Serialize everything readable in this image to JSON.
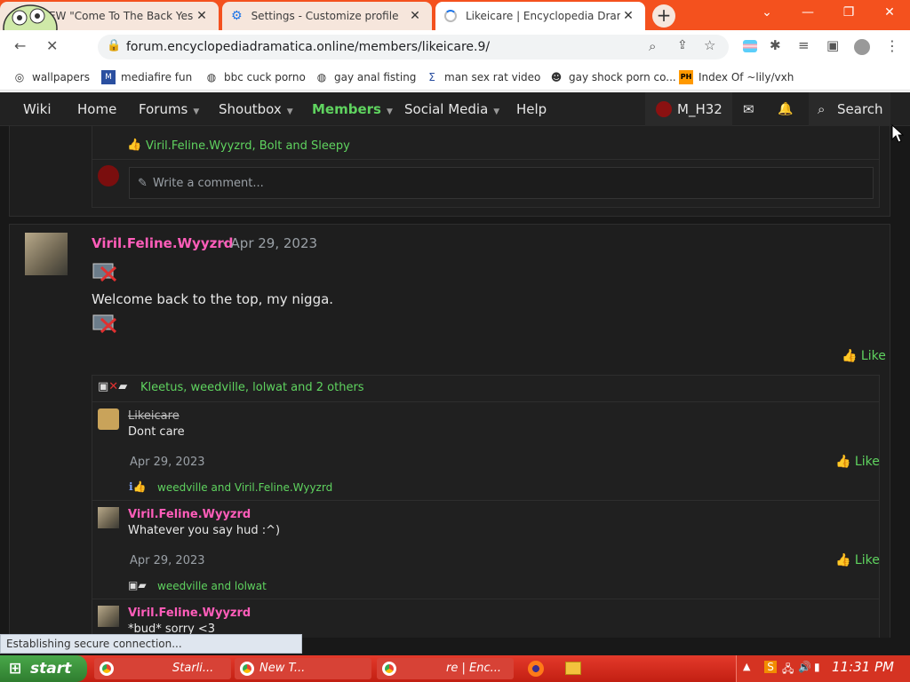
{
  "browser": {
    "tabs": [
      {
        "title": "NEW \"Come To The Back Yes",
        "state": "inactive"
      },
      {
        "title": "Settings - Customize profile",
        "state": "inactive"
      },
      {
        "title": "Likeicare | Encyclopedia Drama",
        "state": "active"
      }
    ],
    "new_tab": "+",
    "url": "forum.encyclopediadramatica.online/members/likeicare.9/",
    "bookmarks": [
      {
        "label": "wallpapers",
        "icon": "coil-icon"
      },
      {
        "label": "mediafire fun",
        "icon": "mediafire-icon"
      },
      {
        "label": "bbc cuck porno",
        "icon": "globe-icon"
      },
      {
        "label": "gay anal fisting",
        "icon": "globe-icon"
      },
      {
        "label": "man sex rat video",
        "icon": "sigma-icon"
      },
      {
        "label": "gay shock porn co...",
        "icon": "mascot-icon"
      },
      {
        "label": "Index Of ~lily/vxh",
        "icon": "ph-icon"
      }
    ]
  },
  "forum_nav": {
    "items": [
      "Wiki",
      "Home",
      "Forums",
      "Shoutbox",
      "Members",
      "Social Media",
      "Help"
    ],
    "active": "Members",
    "user": "M_H32",
    "search": "Search"
  },
  "top_post": {
    "reactions": "Viril.Feline.Wyyzrd, Bolt and Sleepy",
    "comment_placeholder": "Write a comment..."
  },
  "post": {
    "author": "Viril.Feline.Wyyzrd",
    "date": "· Apr 29, 2023",
    "body": "Welcome back to the top, my nigga.",
    "like": "Like",
    "reactions": "Kleetus, weedville, lolwat and 2 others",
    "replies": [
      {
        "author": "Likeicare",
        "body": "Dont care",
        "date": "Apr 29, 2023",
        "like": "Like",
        "reactions": "weedville and Viril.Feline.Wyyzrd"
      },
      {
        "author": "Viril.Feline.Wyyzrd",
        "body": "Whatever you say hud :^)",
        "date": "Apr 29, 2023",
        "like": "Like",
        "reactions": "weedville and lolwat"
      },
      {
        "author": "Viril.Feline.Wyyzrd",
        "body": "*bud* sorry <3"
      }
    ]
  },
  "status_bar": "Establishing secure connection...",
  "taskbar": {
    "start": "start",
    "buttons": [
      "Starli...",
      "New T...",
      "re | Enc..."
    ],
    "clock": "11:31 PM"
  }
}
